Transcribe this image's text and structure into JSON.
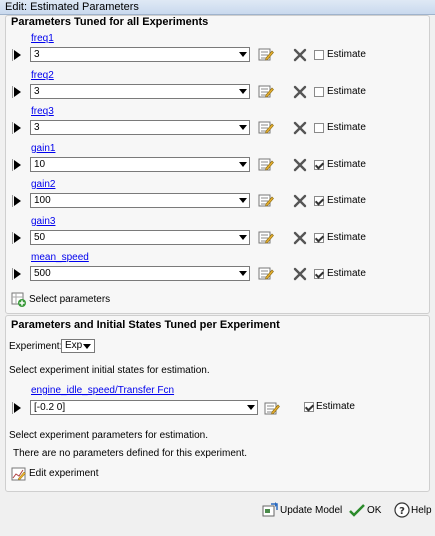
{
  "window": {
    "title": "Edit: Estimated Parameters"
  },
  "global_panel": {
    "title": "Parameters Tuned for all Experiments",
    "parameters": [
      {
        "name": "freq1",
        "value": "3",
        "estimate_label": "Estimate",
        "estimate_checked": false
      },
      {
        "name": "freq2",
        "value": "3",
        "estimate_label": "Estimate",
        "estimate_checked": false
      },
      {
        "name": "freq3",
        "value": "3",
        "estimate_label": "Estimate",
        "estimate_checked": false
      },
      {
        "name": "gain1",
        "value": "10",
        "estimate_label": "Estimate",
        "estimate_checked": true
      },
      {
        "name": "gain2",
        "value": "100",
        "estimate_label": "Estimate",
        "estimate_checked": true
      },
      {
        "name": "gain3",
        "value": "50",
        "estimate_label": "Estimate",
        "estimate_checked": true
      },
      {
        "name": "mean_speed",
        "value": "500",
        "estimate_label": "Estimate",
        "estimate_checked": true
      }
    ],
    "select_parameters_label": "Select parameters"
  },
  "experiment_panel": {
    "title": "Parameters and Initial States Tuned per Experiment",
    "experiment_label": "Experiment:",
    "experiment_value": "Exp",
    "initial_states_text": "Select experiment initial states for estimation.",
    "state": {
      "name": "engine_idle_speed/Transfer Fcn",
      "value": "[-0.2 0]",
      "estimate_label": "Estimate",
      "estimate_checked": true
    },
    "params_text": "Select experiment parameters for estimation.",
    "no_params_text": "There are no parameters defined for this experiment.",
    "edit_experiment_label": "Edit experiment"
  },
  "footer": {
    "update_model_label": "Update Model",
    "ok_label": "OK",
    "help_label": "Help"
  }
}
